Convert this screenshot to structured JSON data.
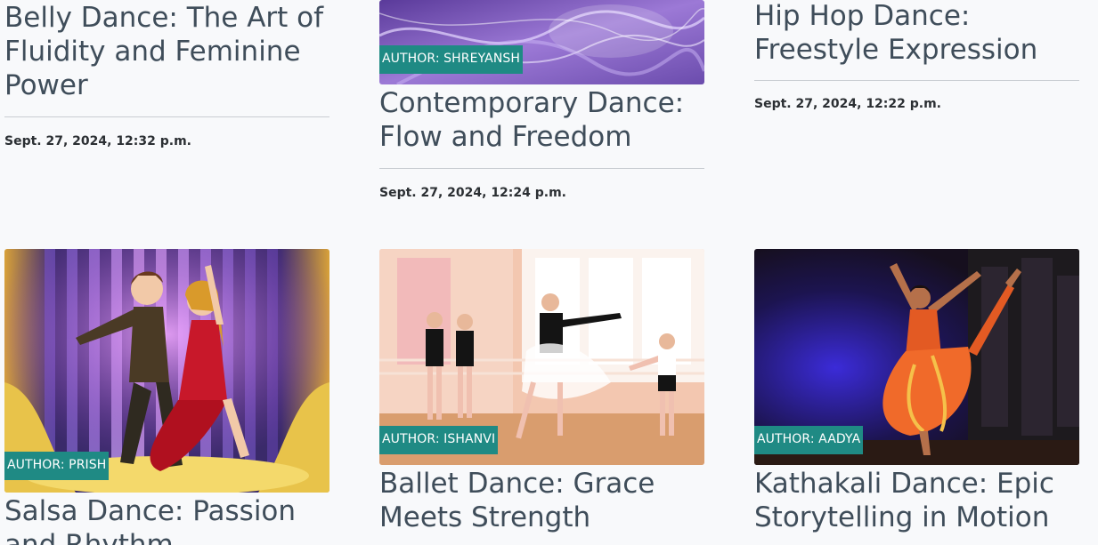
{
  "posts": [
    {
      "title": "Belly Dance: The Art of Fluidity and Feminine Power",
      "date": "Sept. 27, 2024, 12:32 p.m."
    },
    {
      "title": "Contemporary Dance: Flow and Freedom",
      "author": "AUTHOR: SHREYANSH",
      "date": "Sept. 27, 2024, 12:24 p.m."
    },
    {
      "title": "Hip Hop Dance: Freestyle Expression",
      "date": "Sept. 27, 2024, 12:22 p.m."
    },
    {
      "title": "Salsa Dance: Passion and Rhythm",
      "author": "AUTHOR: PRISH"
    },
    {
      "title": "Ballet Dance: Grace Meets Strength",
      "author": "AUTHOR: ISHANVI"
    },
    {
      "title": "Kathakali Dance: Epic Storytelling in Motion",
      "author": "AUTHOR: AADYA"
    }
  ],
  "colors": {
    "badge": "#1f8a84",
    "background": "#f8f9fb",
    "title": "#3f4d5a"
  }
}
